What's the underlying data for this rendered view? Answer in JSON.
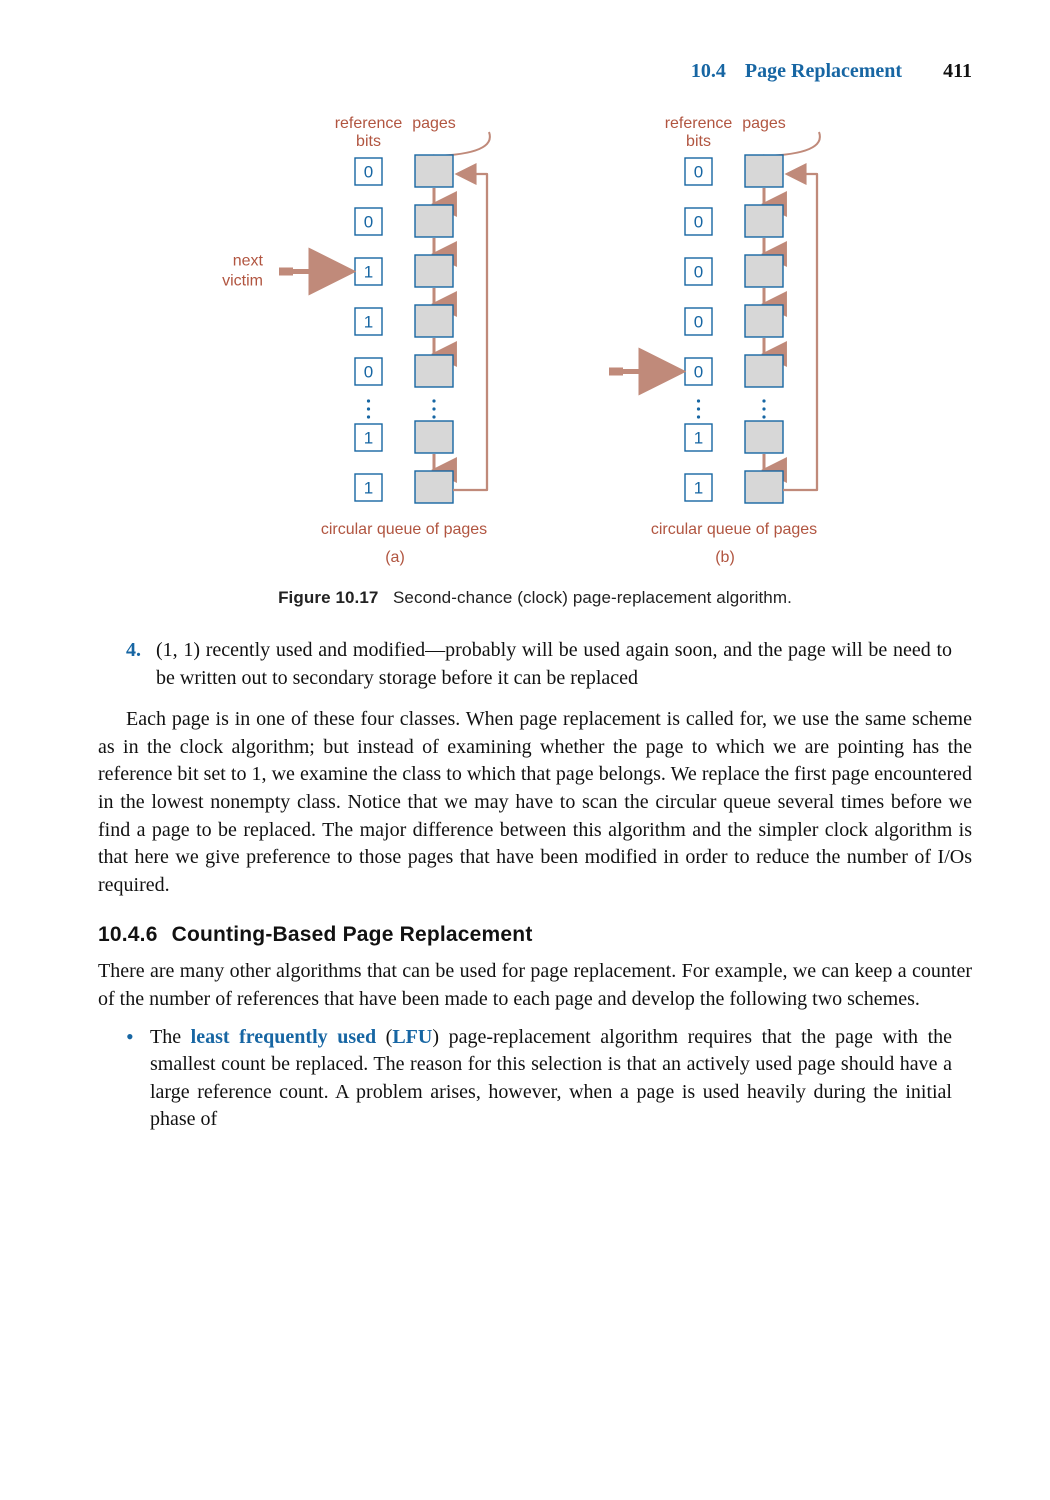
{
  "header": {
    "section_number": "10.4",
    "section_title": "Page Replacement",
    "page_number": "411"
  },
  "figure": {
    "labels": {
      "ref_bits": "reference bits",
      "pages": "pages",
      "next_victim": "next victim",
      "circular_queue": "circular queue of pages",
      "a": "(a)",
      "b": "(b)"
    },
    "left_bits": [
      "0",
      "0",
      "1",
      "1",
      "0",
      "1",
      "1"
    ],
    "right_bits": [
      "0",
      "0",
      "0",
      "0",
      "0",
      "1",
      "1"
    ],
    "left_victim_index": 2,
    "right_victim_index": 4,
    "caption_label": "Figure 10.17",
    "caption_text": "Second-chance (clock) page-replacement algorithm."
  },
  "paragraphs": {
    "item4_marker": "4.",
    "item4_text": "(1, 1) recently used and modified—probably will be used again soon, and the page will be need to be written out to secondary storage before it can be replaced",
    "p_main": "Each page is in one of these four classes. When page replacement is called for, we use the same scheme as in the clock algorithm; but instead of examining whether the page to which we are pointing has the reference bit set to 1, we examine the class to which that page belongs. We replace the first page encountered in the lowest nonempty class. Notice that we may have to scan the circular queue several times before we find a page to be replaced. The major difference between this algorithm and the simpler clock algorithm is that here we give preference to those pages that have been modified in order to reduce the number of ",
    "p_main_tail": "s required.",
    "io": "I/O"
  },
  "section": {
    "number": "10.4.6",
    "title": "Counting-Based Page Replacement",
    "p_intro": "There are many other algorithms that can be used for page replacement. For example, we can keep a counter of the number of references that have been made to each page and develop the following two schemes."
  },
  "bullet": {
    "pre": "The ",
    "term": "least frequently used",
    "paren_open": " (",
    "acr": "LFU",
    "paren_close": ") ",
    "text": "page-replacement algorithm requires that the page with the smallest count be replaced. The reason for this selection is that an actively used page should have a large reference count. A problem arises, however, when a page is used heavily during the initial phase of"
  },
  "chart_data": {
    "type": "diagram",
    "description": "Two circular queues of pages with reference bits; pointer (next victim) moves down the queue",
    "left": {
      "label": "(a)",
      "reference_bits": [
        0,
        0,
        1,
        1,
        0,
        1,
        1
      ],
      "pointer_row": 2
    },
    "right": {
      "label": "(b)",
      "reference_bits": [
        0,
        0,
        0,
        0,
        0,
        1,
        1
      ],
      "pointer_row": 4
    }
  }
}
